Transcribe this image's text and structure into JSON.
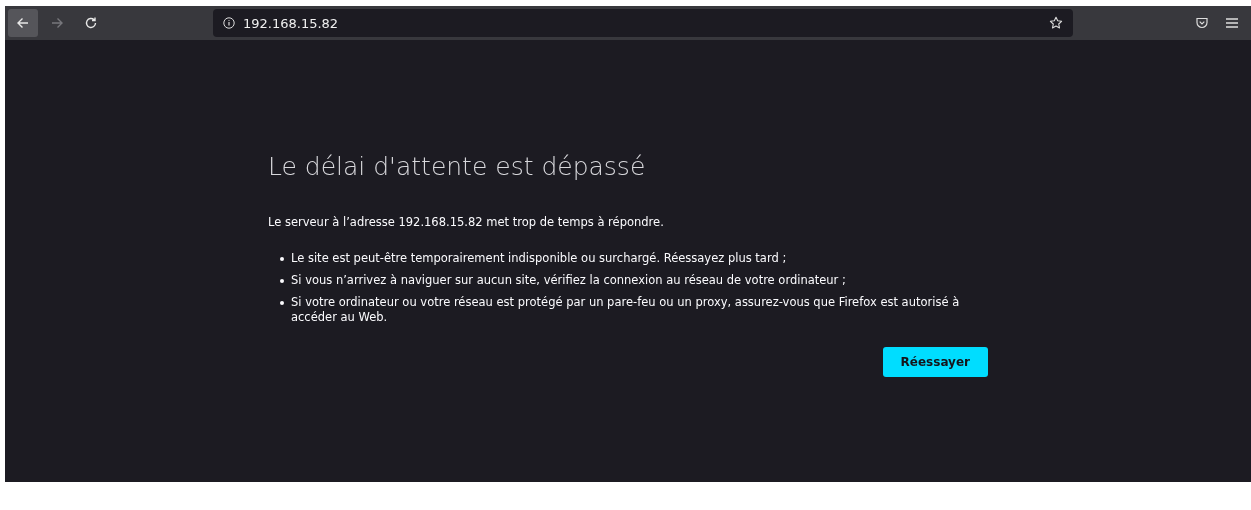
{
  "toolbar": {
    "nav_buttons": [
      {
        "kind": "back",
        "disabled": false,
        "highlighted": true
      },
      {
        "kind": "forward",
        "disabled": true,
        "highlighted": false
      },
      {
        "kind": "reload",
        "disabled": false,
        "highlighted": false
      }
    ],
    "address_bar": {
      "value": "192.168.15.82"
    }
  },
  "error_page": {
    "title": "Le délai d'attente est dépassé",
    "message": "Le serveur à l’adresse 192.168.15.82 met trop de temps à répondre.",
    "suggestions": [
      "Le site est peut-être temporairement indisponible ou surchargé. Réessayez plus tard ;",
      "Si vous n’arrivez à naviguer sur aucun site, vérifiez la connexion au réseau de votre ordinateur ;",
      "Si votre ordinateur ou votre réseau est protégé par un pare-feu ou un proxy, assurez-vous que Firefox est autorisé à accéder au Web."
    ],
    "retry_button": "Réessayer"
  }
}
